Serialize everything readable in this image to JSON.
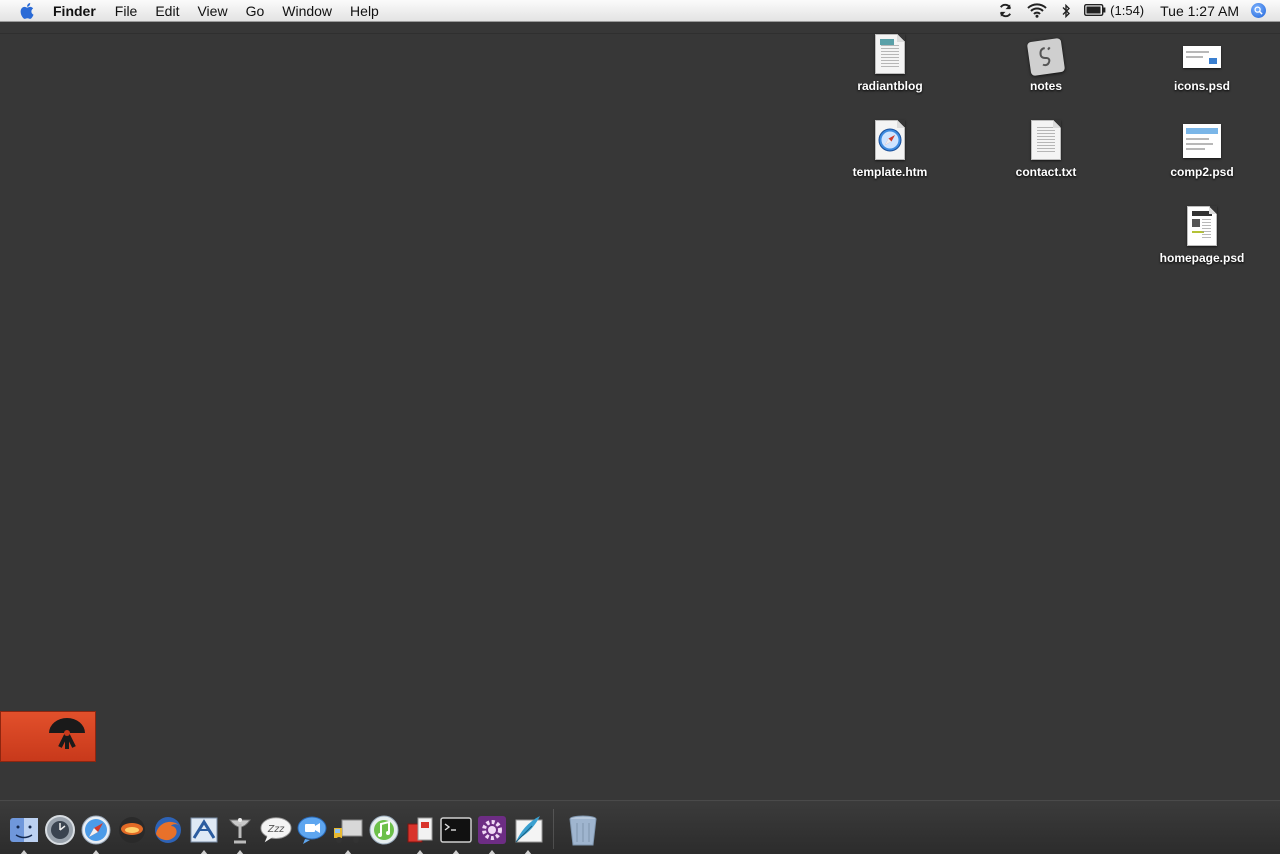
{
  "menubar": {
    "apple_icon": "apple-logo-icon",
    "app_name": "Finder",
    "items": [
      "File",
      "Edit",
      "View",
      "Go",
      "Window",
      "Help"
    ],
    "status": {
      "sync_icon": "sync-icon",
      "wifi_icon": "wifi-icon",
      "bluetooth_icon": "bluetooth-icon",
      "battery_icon": "battery-icon",
      "battery_time": "(1:54)",
      "clock": "Tue 1:27 AM",
      "spotlight_icon": "spotlight-icon"
    }
  },
  "desktop_icons": [
    {
      "label": "radiantblog",
      "type": "document"
    },
    {
      "label": "notes",
      "type": "text-document"
    },
    {
      "label": "icons.psd",
      "type": "psd"
    },
    {
      "label": "template.htm",
      "type": "html"
    },
    {
      "label": "contact.txt",
      "type": "text-document"
    },
    {
      "label": "comp2.psd",
      "type": "psd"
    },
    {
      "label": "homepage.psd",
      "type": "psd"
    }
  ],
  "widget": {
    "icon": "radar-dish-icon",
    "color": "#d9441f"
  },
  "dock": {
    "apps": [
      {
        "name": "finder-icon",
        "running": true
      },
      {
        "name": "time-machine-icon",
        "running": false
      },
      {
        "name": "safari-icon",
        "running": true
      },
      {
        "name": "rss-reader-icon",
        "running": false
      },
      {
        "name": "firefox-icon",
        "running": false
      },
      {
        "name": "mail-icon",
        "running": true
      },
      {
        "name": "satellite-dish-icon",
        "running": true
      },
      {
        "name": "chat-bubble-icon",
        "running": false
      },
      {
        "name": "video-chat-icon",
        "running": false
      },
      {
        "name": "delivery-truck-icon",
        "running": true
      },
      {
        "name": "itunes-icon",
        "running": false
      },
      {
        "name": "app-bundle-icon",
        "running": true
      },
      {
        "name": "terminal-icon",
        "running": true
      },
      {
        "name": "gear-icon",
        "running": true
      },
      {
        "name": "quill-pen-icon",
        "running": true
      }
    ],
    "trash_icon": "trash-icon"
  }
}
